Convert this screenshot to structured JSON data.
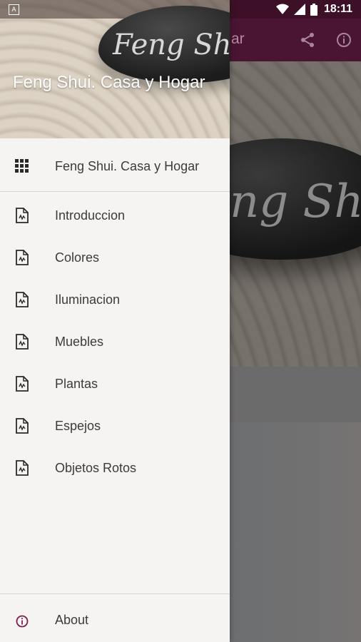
{
  "status_bar": {
    "time": "18:11",
    "icons": [
      "wifi-icon",
      "signal-icon",
      "battery-icon"
    ]
  },
  "toolbar": {
    "title_fragment": "ar",
    "icons": [
      "share-icon",
      "info-icon"
    ]
  },
  "hero": {
    "stone_text": "ng Shui"
  },
  "drawer": {
    "header": {
      "stone_text": "Feng Shui",
      "title": "Feng Shui. Casa y Hogar"
    },
    "home_item": {
      "label": "Feng Shui. Casa y Hogar",
      "icon": "apps-grid-icon"
    },
    "items": [
      {
        "label": "Introduccion",
        "icon": "document-icon"
      },
      {
        "label": "Colores",
        "icon": "document-icon"
      },
      {
        "label": "Iluminacion",
        "icon": "document-icon"
      },
      {
        "label": "Muebles",
        "icon": "document-icon"
      },
      {
        "label": "Plantas",
        "icon": "document-icon"
      },
      {
        "label": "Espejos",
        "icon": "document-icon"
      },
      {
        "label": "Objetos Rotos",
        "icon": "document-icon"
      }
    ],
    "about_item": {
      "label": "About",
      "icon": "info-icon"
    }
  },
  "colors": {
    "status_bar": "#3d1027",
    "toolbar": "#4a1533",
    "accent": "#7a1f4e",
    "drawer_bg": "#f6f4f2"
  }
}
